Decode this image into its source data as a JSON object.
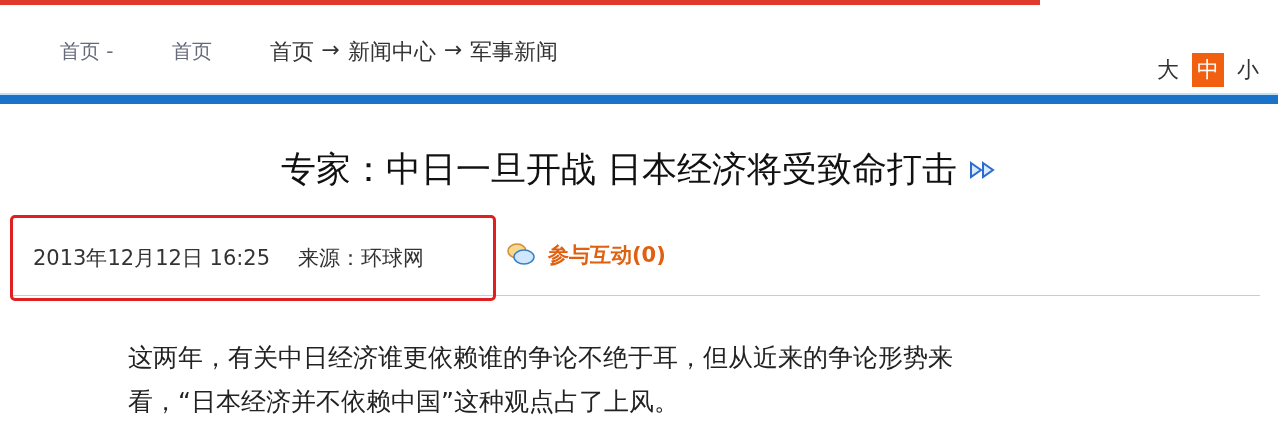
{
  "ghost_crumbs": [
    "首页 -",
    "首页"
  ],
  "breadcrumb": [
    "首页",
    "→",
    "新闻中心",
    "→",
    "军事新闻"
  ],
  "font_sizes": [
    {
      "label": "大",
      "selected": false
    },
    {
      "label": "中",
      "selected": true
    },
    {
      "label": "小",
      "selected": false
    }
  ],
  "article": {
    "title": "专家：中日一旦开战 日本经济将受致命打击",
    "date": "2013年12月12日 16:25",
    "source": "来源：环球网",
    "interact": "参与互动(0)",
    "paragraphs": [
      "这两年，有关中日经济谁更依赖谁的争论不绝于耳，但从近来的争论形势来",
      "看，“日本经济并不依赖中国”这种观点占了上风。"
    ]
  }
}
